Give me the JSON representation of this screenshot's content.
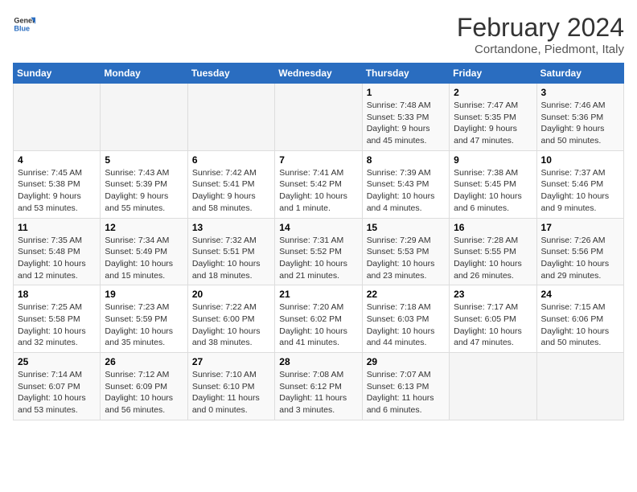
{
  "logo": {
    "line1": "General",
    "line2": "Blue"
  },
  "header": {
    "month": "February 2024",
    "location": "Cortandone, Piedmont, Italy"
  },
  "weekdays": [
    "Sunday",
    "Monday",
    "Tuesday",
    "Wednesday",
    "Thursday",
    "Friday",
    "Saturday"
  ],
  "weeks": [
    [
      {
        "day": "",
        "info": ""
      },
      {
        "day": "",
        "info": ""
      },
      {
        "day": "",
        "info": ""
      },
      {
        "day": "",
        "info": ""
      },
      {
        "day": "1",
        "info": "Sunrise: 7:48 AM\nSunset: 5:33 PM\nDaylight: 9 hours\nand 45 minutes."
      },
      {
        "day": "2",
        "info": "Sunrise: 7:47 AM\nSunset: 5:35 PM\nDaylight: 9 hours\nand 47 minutes."
      },
      {
        "day": "3",
        "info": "Sunrise: 7:46 AM\nSunset: 5:36 PM\nDaylight: 9 hours\nand 50 minutes."
      }
    ],
    [
      {
        "day": "4",
        "info": "Sunrise: 7:45 AM\nSunset: 5:38 PM\nDaylight: 9 hours\nand 53 minutes."
      },
      {
        "day": "5",
        "info": "Sunrise: 7:43 AM\nSunset: 5:39 PM\nDaylight: 9 hours\nand 55 minutes."
      },
      {
        "day": "6",
        "info": "Sunrise: 7:42 AM\nSunset: 5:41 PM\nDaylight: 9 hours\nand 58 minutes."
      },
      {
        "day": "7",
        "info": "Sunrise: 7:41 AM\nSunset: 5:42 PM\nDaylight: 10 hours\nand 1 minute."
      },
      {
        "day": "8",
        "info": "Sunrise: 7:39 AM\nSunset: 5:43 PM\nDaylight: 10 hours\nand 4 minutes."
      },
      {
        "day": "9",
        "info": "Sunrise: 7:38 AM\nSunset: 5:45 PM\nDaylight: 10 hours\nand 6 minutes."
      },
      {
        "day": "10",
        "info": "Sunrise: 7:37 AM\nSunset: 5:46 PM\nDaylight: 10 hours\nand 9 minutes."
      }
    ],
    [
      {
        "day": "11",
        "info": "Sunrise: 7:35 AM\nSunset: 5:48 PM\nDaylight: 10 hours\nand 12 minutes."
      },
      {
        "day": "12",
        "info": "Sunrise: 7:34 AM\nSunset: 5:49 PM\nDaylight: 10 hours\nand 15 minutes."
      },
      {
        "day": "13",
        "info": "Sunrise: 7:32 AM\nSunset: 5:51 PM\nDaylight: 10 hours\nand 18 minutes."
      },
      {
        "day": "14",
        "info": "Sunrise: 7:31 AM\nSunset: 5:52 PM\nDaylight: 10 hours\nand 21 minutes."
      },
      {
        "day": "15",
        "info": "Sunrise: 7:29 AM\nSunset: 5:53 PM\nDaylight: 10 hours\nand 23 minutes."
      },
      {
        "day": "16",
        "info": "Sunrise: 7:28 AM\nSunset: 5:55 PM\nDaylight: 10 hours\nand 26 minutes."
      },
      {
        "day": "17",
        "info": "Sunrise: 7:26 AM\nSunset: 5:56 PM\nDaylight: 10 hours\nand 29 minutes."
      }
    ],
    [
      {
        "day": "18",
        "info": "Sunrise: 7:25 AM\nSunset: 5:58 PM\nDaylight: 10 hours\nand 32 minutes."
      },
      {
        "day": "19",
        "info": "Sunrise: 7:23 AM\nSunset: 5:59 PM\nDaylight: 10 hours\nand 35 minutes."
      },
      {
        "day": "20",
        "info": "Sunrise: 7:22 AM\nSunset: 6:00 PM\nDaylight: 10 hours\nand 38 minutes."
      },
      {
        "day": "21",
        "info": "Sunrise: 7:20 AM\nSunset: 6:02 PM\nDaylight: 10 hours\nand 41 minutes."
      },
      {
        "day": "22",
        "info": "Sunrise: 7:18 AM\nSunset: 6:03 PM\nDaylight: 10 hours\nand 44 minutes."
      },
      {
        "day": "23",
        "info": "Sunrise: 7:17 AM\nSunset: 6:05 PM\nDaylight: 10 hours\nand 47 minutes."
      },
      {
        "day": "24",
        "info": "Sunrise: 7:15 AM\nSunset: 6:06 PM\nDaylight: 10 hours\nand 50 minutes."
      }
    ],
    [
      {
        "day": "25",
        "info": "Sunrise: 7:14 AM\nSunset: 6:07 PM\nDaylight: 10 hours\nand 53 minutes."
      },
      {
        "day": "26",
        "info": "Sunrise: 7:12 AM\nSunset: 6:09 PM\nDaylight: 10 hours\nand 56 minutes."
      },
      {
        "day": "27",
        "info": "Sunrise: 7:10 AM\nSunset: 6:10 PM\nDaylight: 11 hours\nand 0 minutes."
      },
      {
        "day": "28",
        "info": "Sunrise: 7:08 AM\nSunset: 6:12 PM\nDaylight: 11 hours\nand 3 minutes."
      },
      {
        "day": "29",
        "info": "Sunrise: 7:07 AM\nSunset: 6:13 PM\nDaylight: 11 hours\nand 6 minutes."
      },
      {
        "day": "",
        "info": ""
      },
      {
        "day": "",
        "info": ""
      }
    ]
  ]
}
